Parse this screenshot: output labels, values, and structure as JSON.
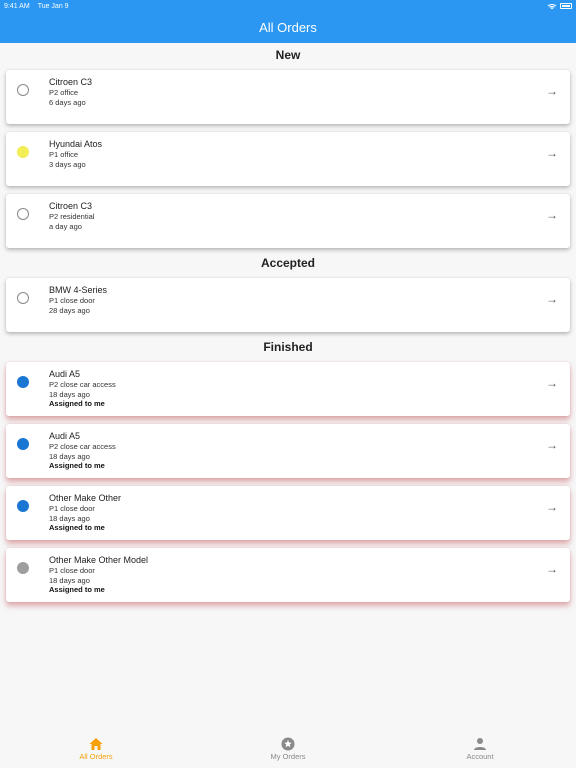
{
  "status_bar": {
    "time": "9:41 AM",
    "date": "Tue Jan 9",
    "battery": "100%"
  },
  "header": {
    "title": "All Orders"
  },
  "sections": [
    {
      "title": "New"
    },
    {
      "title": "Accepted"
    },
    {
      "title": "Finished"
    }
  ],
  "orders": [
    {
      "title": "Citroen C3",
      "line1": "P2 office",
      "line2": "6 days ago",
      "status_color": "empty",
      "assigned": ""
    },
    {
      "title": "Hyundai Atos",
      "line1": "P1 office",
      "line2": "3 days ago",
      "status_color": "#f3ee55",
      "assigned": ""
    },
    {
      "title": "Citroen C3",
      "line1": "P2 residential",
      "line2": "a day ago",
      "status_color": "empty",
      "assigned": ""
    },
    {
      "title": "BMW 4-Series",
      "line1": "P1 close door",
      "line2": "28 days ago",
      "status_color": "empty",
      "assigned": ""
    },
    {
      "title": "Audi A5",
      "line1": "P2 close car access",
      "line2": "18 days ago",
      "status_color": "#1976d2",
      "assigned": "Assigned to me"
    },
    {
      "title": "Audi A5",
      "line1": "P2 close car access",
      "line2": "18 days ago",
      "status_color": "#1976d2",
      "assigned": "Assigned to me"
    },
    {
      "title": "Other Make Other",
      "line1": "P1 close door",
      "line2": "18 days ago",
      "status_color": "#1976d2",
      "assigned": "Assigned to me"
    },
    {
      "title": "Other Make Other Model",
      "line1": "P1 close door",
      "line2": "18 days ago",
      "status_color": "#9e9e9e",
      "assigned": "Assigned to me"
    }
  ],
  "bottom_nav": {
    "items": [
      {
        "label": "All Orders",
        "icon": "home-icon"
      },
      {
        "label": "My Orders",
        "icon": "star-icon"
      },
      {
        "label": "Account",
        "icon": "person-icon"
      }
    ],
    "active_color": "#f4a10c",
    "inactive_color": "#888888"
  },
  "colors": {
    "primary": "#2b97f3"
  }
}
